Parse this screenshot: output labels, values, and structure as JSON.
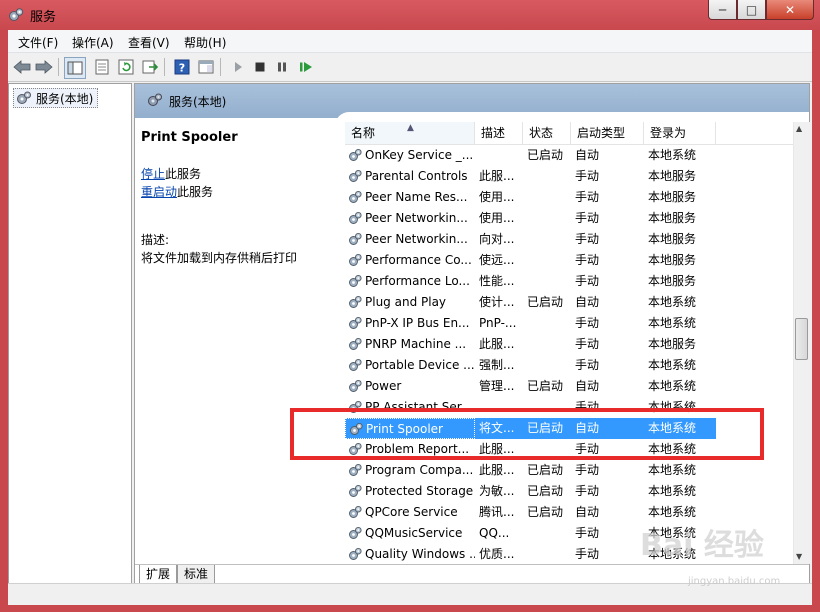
{
  "window": {
    "title": "服务",
    "min_label": "─",
    "max_label": "□",
    "close_label": "✕"
  },
  "menu": [
    "文件(F)",
    "操作(A)",
    "查看(V)",
    "帮助(H)"
  ],
  "tree": {
    "item": "服务(本地)"
  },
  "panel": {
    "header": "服务(本地)",
    "service_title": "Print Spooler",
    "stop_link": "停止",
    "stop_suffix": "此服务",
    "restart_link": "重启动",
    "restart_suffix": "此服务",
    "desc_label": "描述:",
    "desc_text": "将文件加载到内存供稍后打印"
  },
  "columns": [
    "名称",
    "描述",
    "状态",
    "启动类型",
    "登录为"
  ],
  "rows": [
    {
      "name": "OnKey Service _...",
      "desc": "",
      "status": "已启动",
      "startup": "自动",
      "logon": "本地系统"
    },
    {
      "name": "Parental Controls",
      "desc": "此服...",
      "status": "",
      "startup": "手动",
      "logon": "本地服务"
    },
    {
      "name": "Peer Name Res...",
      "desc": "使用...",
      "status": "",
      "startup": "手动",
      "logon": "本地服务"
    },
    {
      "name": "Peer Networkin...",
      "desc": "使用...",
      "status": "",
      "startup": "手动",
      "logon": "本地服务"
    },
    {
      "name": "Peer Networkin...",
      "desc": "向对...",
      "status": "",
      "startup": "手动",
      "logon": "本地服务"
    },
    {
      "name": "Performance Co...",
      "desc": "使远...",
      "status": "",
      "startup": "手动",
      "logon": "本地服务"
    },
    {
      "name": "Performance Lo...",
      "desc": "性能...",
      "status": "",
      "startup": "手动",
      "logon": "本地服务"
    },
    {
      "name": "Plug and Play",
      "desc": "使计...",
      "status": "已启动",
      "startup": "自动",
      "logon": "本地系统"
    },
    {
      "name": "PnP-X IP Bus En...",
      "desc": "PnP-...",
      "status": "",
      "startup": "手动",
      "logon": "本地系统"
    },
    {
      "name": "PNRP Machine ...",
      "desc": "此服...",
      "status": "",
      "startup": "手动",
      "logon": "本地服务"
    },
    {
      "name": "Portable Device ...",
      "desc": "强制...",
      "status": "",
      "startup": "手动",
      "logon": "本地系统"
    },
    {
      "name": "Power",
      "desc": "管理...",
      "status": "已启动",
      "startup": "自动",
      "logon": "本地系统"
    },
    {
      "name": "PP Assistant Ser...",
      "desc": "",
      "status": "",
      "startup": "手动",
      "logon": "本地系统"
    },
    {
      "name": "Print Spooler",
      "desc": "将文...",
      "status": "已启动",
      "startup": "自动",
      "logon": "本地系统",
      "selected": true
    },
    {
      "name": "Problem Report...",
      "desc": "此服...",
      "status": "",
      "startup": "手动",
      "logon": "本地系统"
    },
    {
      "name": "Program Compa...",
      "desc": "此服...",
      "status": "已启动",
      "startup": "手动",
      "logon": "本地系统"
    },
    {
      "name": "Protected Storage",
      "desc": "为敏...",
      "status": "已启动",
      "startup": "手动",
      "logon": "本地系统"
    },
    {
      "name": "QPCore Service",
      "desc": "腾讯...",
      "status": "已启动",
      "startup": "自动",
      "logon": "本地系统"
    },
    {
      "name": "QQMusicService",
      "desc": "QQ...",
      "status": "",
      "startup": "手动",
      "logon": "本地系统"
    },
    {
      "name": "Quality Windows ...",
      "desc": "优质...",
      "status": "",
      "startup": "手动",
      "logon": "本地系统"
    }
  ],
  "tabs": [
    "扩展",
    "标准"
  ],
  "watermark": {
    "main": "Bai 经验",
    "sub": "jingyan.baidu.com"
  },
  "colors": {
    "selection": "#3399ff",
    "highlight_box": "#e82a2a",
    "header_band": "#a8c0da"
  }
}
